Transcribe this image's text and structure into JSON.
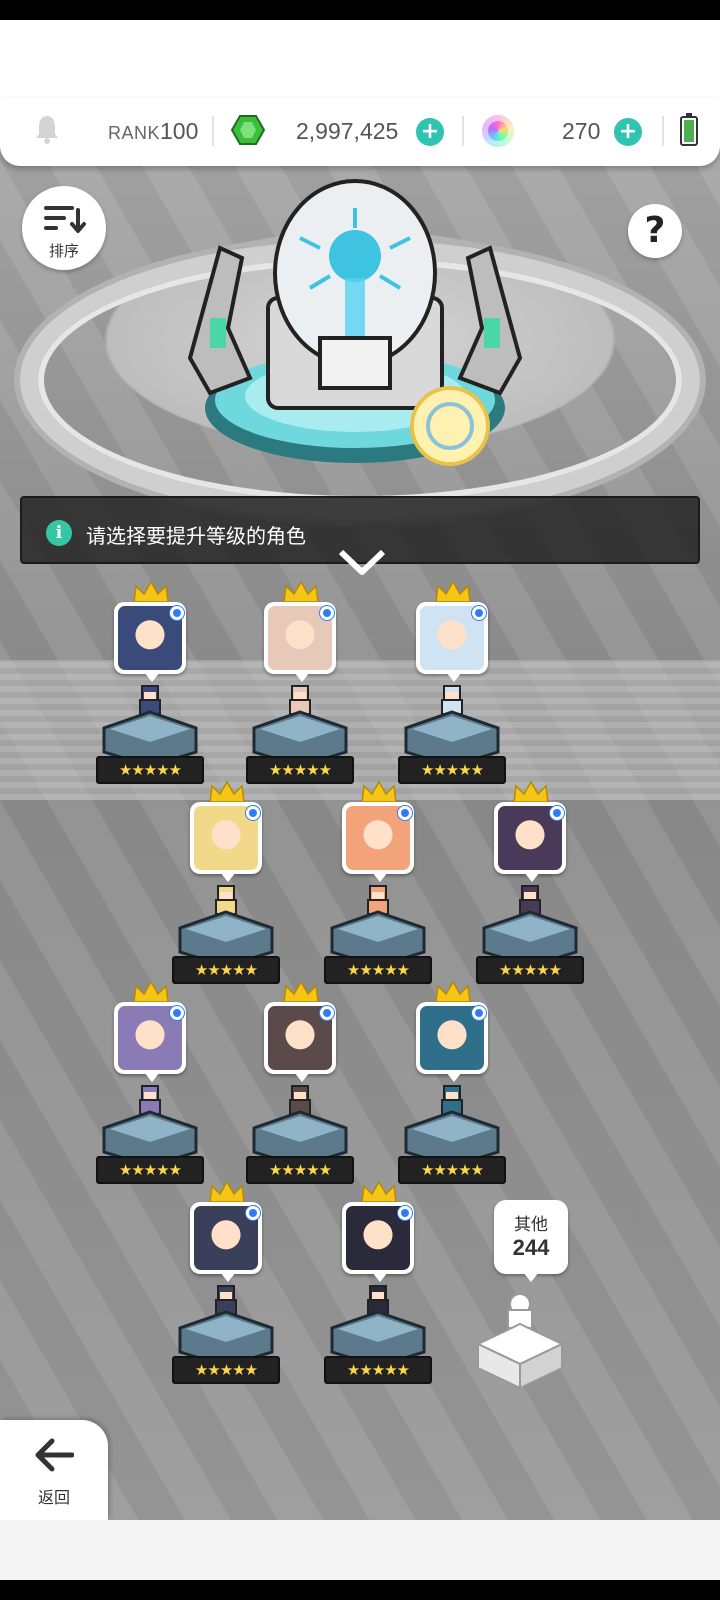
{
  "topbar": {
    "rank_label": "RANK",
    "rank_value": "100",
    "gold_value": "2,997,425",
    "orb_value": "270",
    "icons": [
      "bell-icon",
      "green-gem-icon",
      "plus-icon",
      "rainbow-orb-icon",
      "battery-icon"
    ]
  },
  "controls": {
    "sort_label": "排序",
    "help_symbol": "?",
    "back_label": "返回"
  },
  "banner": {
    "info_symbol": "i",
    "text": "请选择要提升等级的角色"
  },
  "heroes": [
    {
      "stars": "★★★★★",
      "color": "#3a4a7a"
    },
    {
      "stars": "★★★★★",
      "color": "#e8c8b8"
    },
    {
      "stars": "★★★★★",
      "color": "#cfe3f2"
    },
    {
      "stars": "★★★★★",
      "color": "#f2d98a"
    },
    {
      "stars": "★★★★★",
      "color": "#f2a37a"
    },
    {
      "stars": "★★★★★",
      "color": "#4a3a5a"
    },
    {
      "stars": "★★★★★",
      "color": "#8a7ab5"
    },
    {
      "stars": "★★★★★",
      "color": "#5a4a4a"
    },
    {
      "stars": "★★★★★",
      "color": "#2f6f8a"
    },
    {
      "stars": "★★★★★",
      "color": "#3a3f5a"
    },
    {
      "stars": "★★★★★",
      "color": "#2a2a3a"
    }
  ],
  "others": {
    "label": "其他",
    "count": "244"
  },
  "colors": {
    "accent": "#2ec4b0",
    "crown": "#f5c518",
    "selected_dot": "#2e7cf6"
  }
}
